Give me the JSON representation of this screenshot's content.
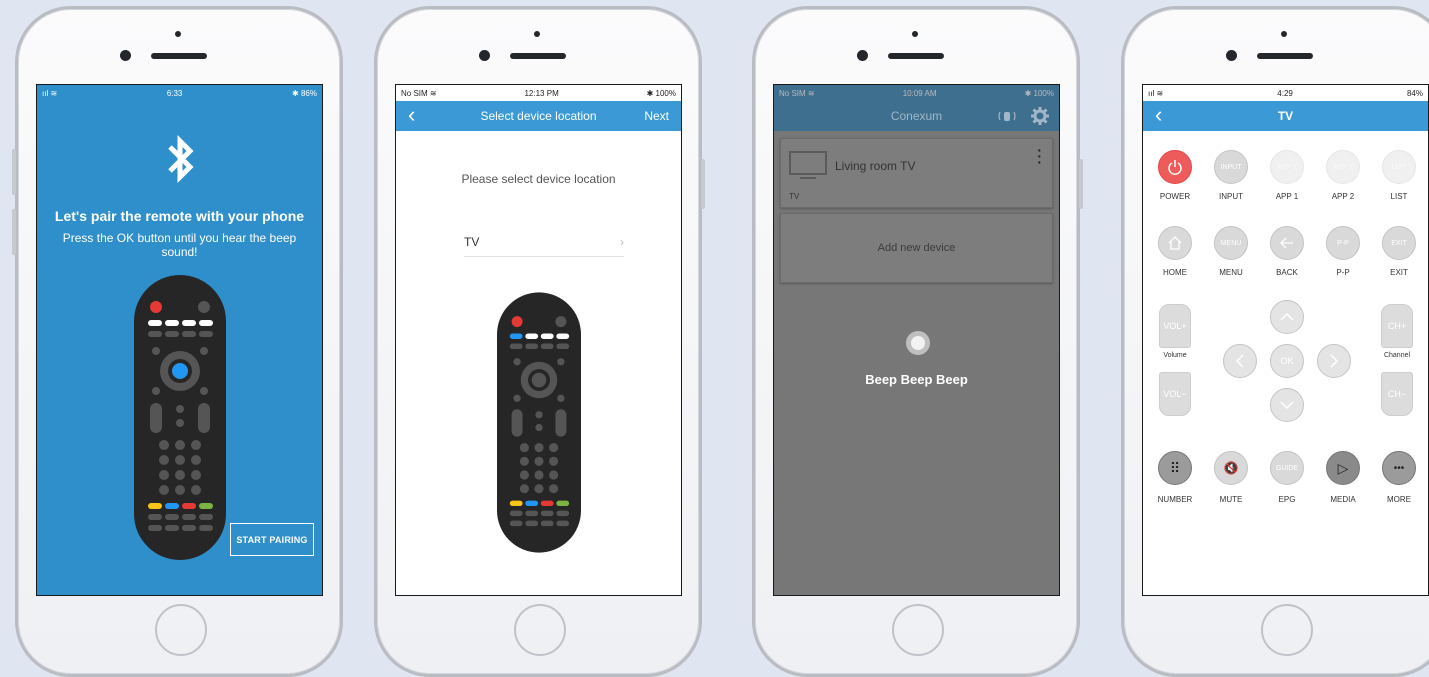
{
  "phone1": {
    "status": {
      "signal": "ııl ≋",
      "time": "6:33",
      "battery": "✱ 86%"
    },
    "title": "Let's pair the remote with your phone",
    "subtitle": "Press the OK button until you hear the beep sound!",
    "start_button": "START PAIRING"
  },
  "phone2": {
    "status": {
      "carrier": "No SIM ≋",
      "time": "12:13 PM",
      "battery": "✱ 100%"
    },
    "nav": {
      "back": "‹",
      "title": "Select device location",
      "next": "Next"
    },
    "prompt": "Please select device location",
    "location": {
      "label": "TV",
      "chevron": "›"
    }
  },
  "phone3": {
    "status": {
      "carrier": "No SIM ≋",
      "time": "10:09 AM",
      "battery": "✱ 100%"
    },
    "nav": {
      "title": "Conexum"
    },
    "device": {
      "name": "Living room TV",
      "type": "TV"
    },
    "add_device": "Add new device",
    "beep": "Beep Beep Beep"
  },
  "phone4": {
    "status": {
      "signal": "ııl ≋",
      "time": "4:29",
      "battery": "84%"
    },
    "nav": {
      "back": "‹",
      "title": "TV"
    },
    "row1": [
      {
        "label": "POWER",
        "btn": ""
      },
      {
        "label": "INPUT",
        "btn": "INPUT"
      },
      {
        "label": "APP 1",
        "btn": "APP 1"
      },
      {
        "label": "APP 2",
        "btn": "APP 2"
      },
      {
        "label": "LIST",
        "btn": "LIST"
      }
    ],
    "row2": [
      {
        "label": "HOME",
        "btn": ""
      },
      {
        "label": "MENU",
        "btn": "MENU"
      },
      {
        "label": "BACK",
        "btn": ""
      },
      {
        "label": "P-P",
        "btn": "P-P"
      },
      {
        "label": "EXIT",
        "btn": "EXIT"
      }
    ],
    "volume": {
      "up": "VOL+",
      "down": "VOL−",
      "label": "Volume"
    },
    "channel": {
      "up": "CH+",
      "down": "CH−",
      "label": "Channel"
    },
    "ok": "OK",
    "row4": [
      {
        "label": "NUMBER",
        "btn": "⠿"
      },
      {
        "label": "MUTE",
        "btn": "🔇"
      },
      {
        "label": "EPG",
        "btn": "GUIDE"
      },
      {
        "label": "MEDIA",
        "btn": "▷"
      },
      {
        "label": "MORE",
        "btn": "•••"
      }
    ]
  },
  "colors": {
    "accent": "#3b9ad6",
    "pair_bg": "#2f8fcb",
    "power": "#ee5b5b",
    "overlay": "#777777"
  },
  "icons": [
    "bluetooth-icon",
    "gear-icon",
    "remote-icon",
    "tv-icon",
    "power-icon",
    "home-icon",
    "back-icon"
  ]
}
